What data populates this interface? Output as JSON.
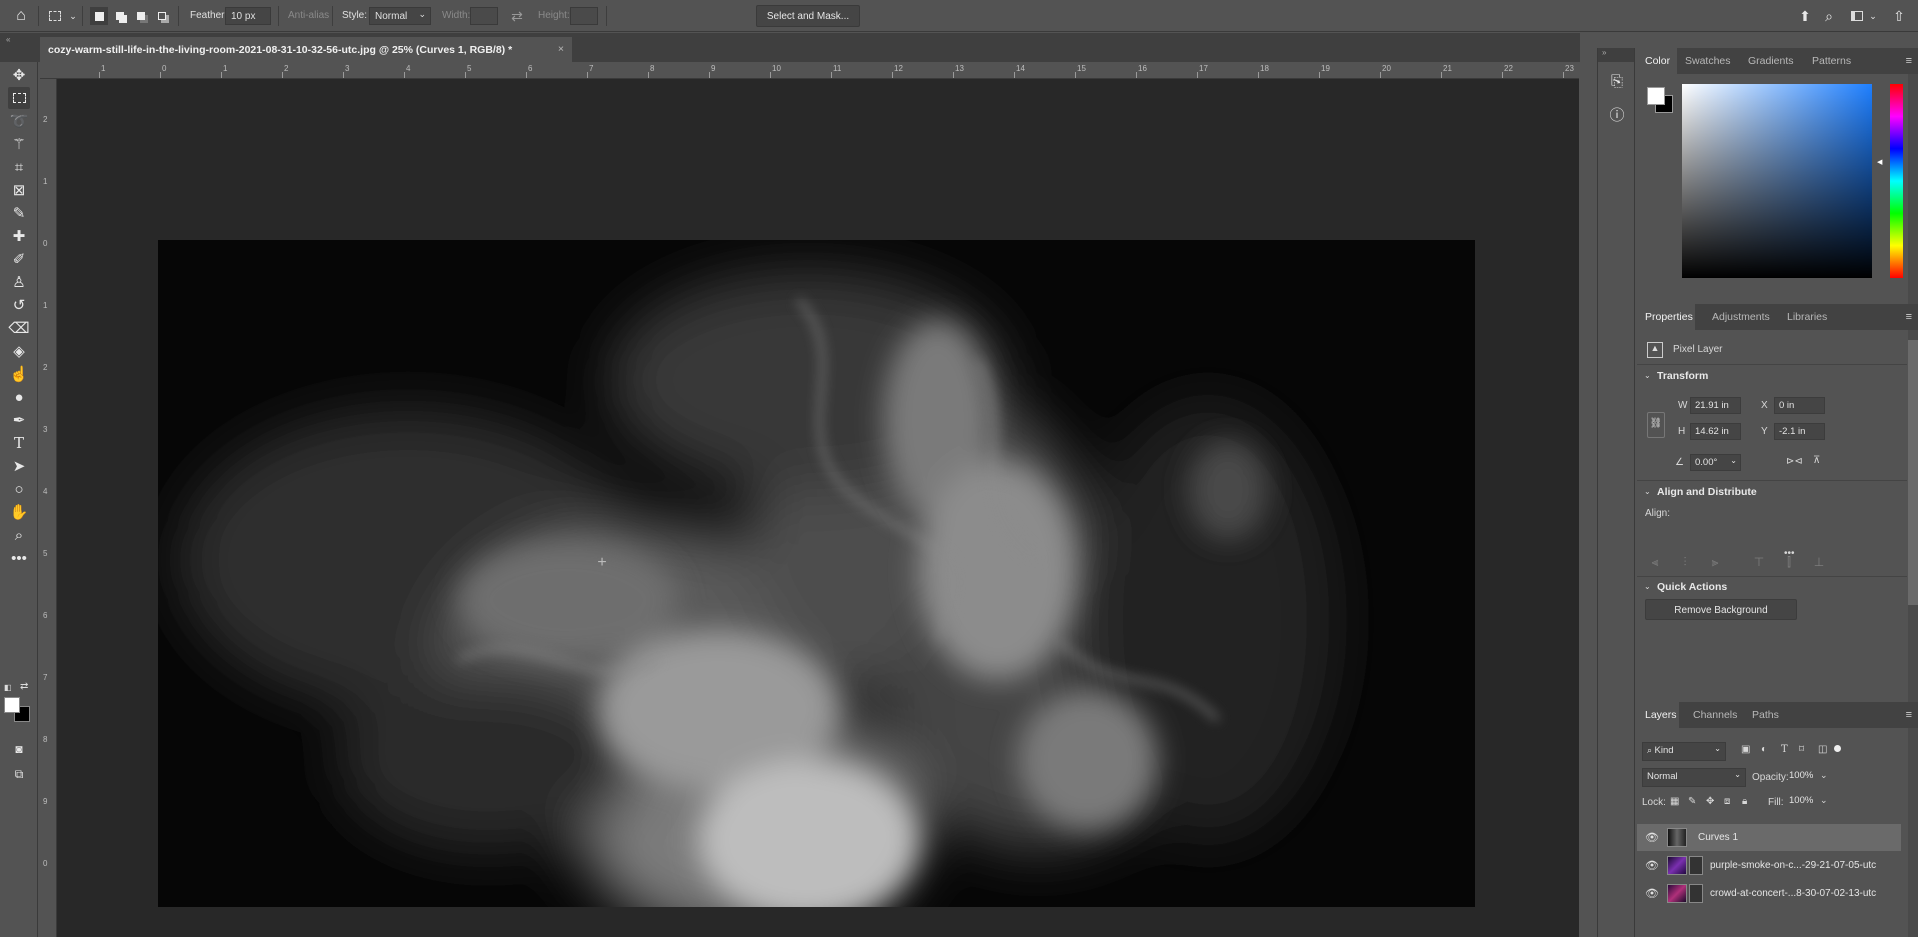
{
  "options_bar": {
    "feather_label": "Feather:",
    "feather_value": "10 px",
    "antialias_label": "Anti-alias",
    "style_label": "Style:",
    "style_value": "Normal",
    "width_label": "Width:",
    "height_label": "Height:",
    "select_mask_label": "Select and Mask..."
  },
  "document": {
    "tab_title": "cozy-warm-still-life-in-the-living-room-2021-08-31-10-32-56-utc.jpg @ 25% (Curves 1, RGB/8) *",
    "close_glyph": "×"
  },
  "rulers": {
    "top_ticks": [
      "1",
      "0",
      "1",
      "2",
      "3",
      "4",
      "5",
      "6",
      "7",
      "8",
      "9",
      "10",
      "11",
      "12",
      "13",
      "14",
      "15",
      "16",
      "17",
      "18",
      "19",
      "20",
      "21",
      "22",
      "23"
    ],
    "left_ticks": [
      "2",
      "1",
      "0",
      "1",
      "2",
      "3",
      "4",
      "5",
      "6",
      "7",
      "8",
      "9",
      "0"
    ]
  },
  "color_panel": {
    "tabs": [
      "Color",
      "Swatches",
      "Gradients",
      "Patterns"
    ],
    "active_tab": "Color"
  },
  "properties_panel": {
    "tabs": [
      "Properties",
      "Adjustments",
      "Libraries"
    ],
    "layer_type": "Pixel Layer",
    "transform_heading": "Transform",
    "w_label": "W",
    "w_value": "21.91 in",
    "h_label": "H",
    "h_value": "14.62 in",
    "x_label": "X",
    "x_value": "0 in",
    "y_label": "Y",
    "y_value": "-2.1 in",
    "angle_value": "0.00°",
    "align_heading": "Align and Distribute",
    "align_label": "Align:",
    "more_glyph": "•••",
    "quick_actions_heading": "Quick Actions",
    "remove_bg_label": "Remove Background"
  },
  "layers_panel": {
    "tabs": [
      "Layers",
      "Channels",
      "Paths"
    ],
    "filter_kind": "Kind",
    "blend_mode": "Normal",
    "opacity_label": "Opacity:",
    "opacity_value": "100%",
    "lock_label": "Lock:",
    "fill_label": "Fill:",
    "fill_value": "100%",
    "layers": [
      {
        "name": "Curves 1"
      },
      {
        "name": "purple-smoke-on-c...-29-21-07-05-utc"
      },
      {
        "name": "crowd-at-concert-...8-30-07-02-13-utc"
      }
    ]
  },
  "colors": {
    "foreground": "#ffffff",
    "background": "#000000",
    "ui_base": "#535353",
    "canvas_bg": "#282828"
  },
  "icons": {
    "home": "home-icon",
    "marquee": "rectangular-marquee-icon",
    "search": "search-icon",
    "share": "share-icon"
  }
}
